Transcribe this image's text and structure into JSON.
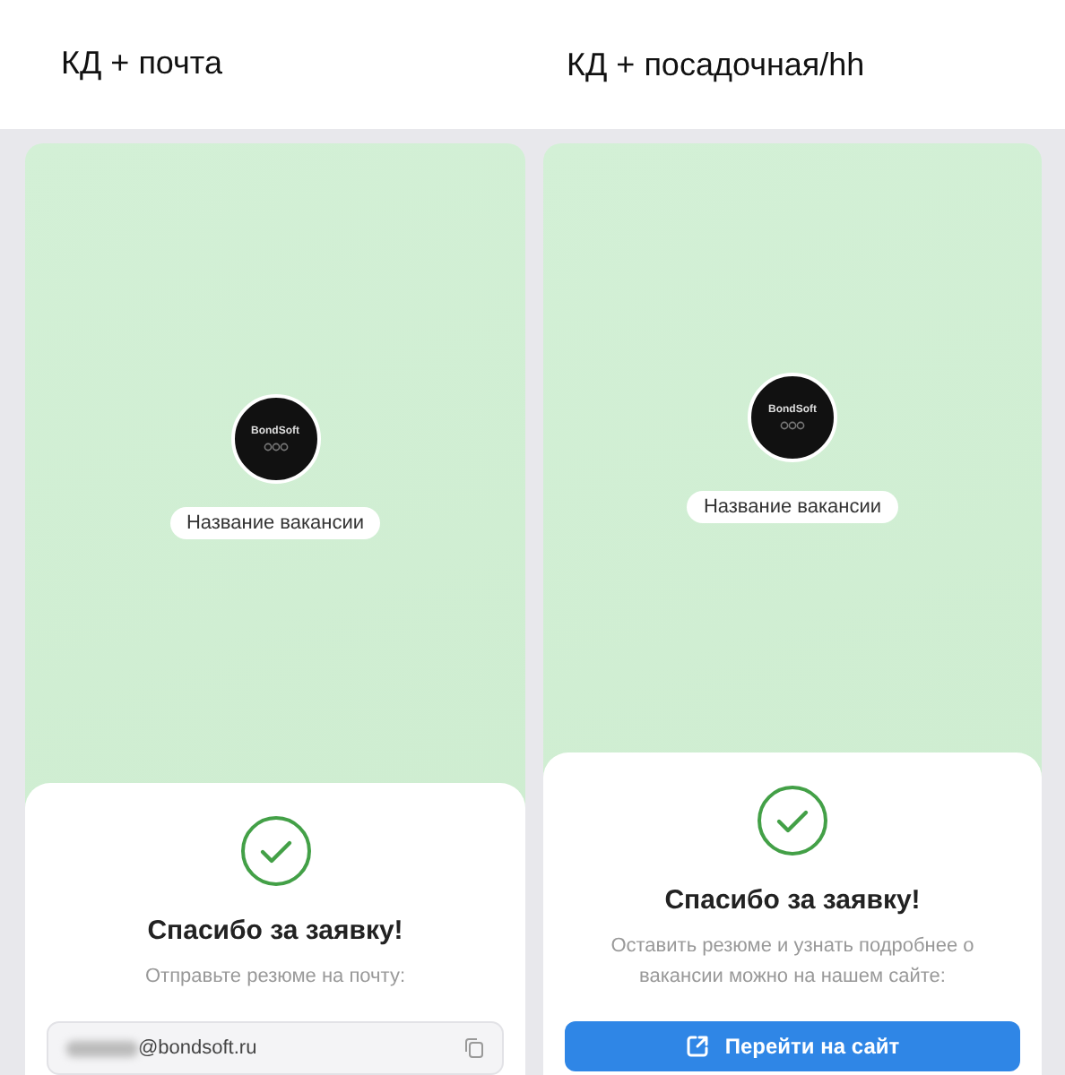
{
  "panels": [
    {
      "title": "КД + почта",
      "kind": "email",
      "logo_text": "BondSoft",
      "vacancy": "Название вакансии",
      "heading": "Спасибо за заявку!",
      "subtitle": "Отправьте резюме на почту:",
      "email": "@bondsoft.ru"
    },
    {
      "title": "КД + посадочная/hh",
      "kind": "site",
      "logo_text": "BondSoft",
      "vacancy": "Название вакансии",
      "heading": "Спасибо за заявку!",
      "subtitle": "Оставить резюме и узнать подробнее о вакансии можно на нашем сайте:",
      "button": "Перейти на сайт"
    }
  ]
}
